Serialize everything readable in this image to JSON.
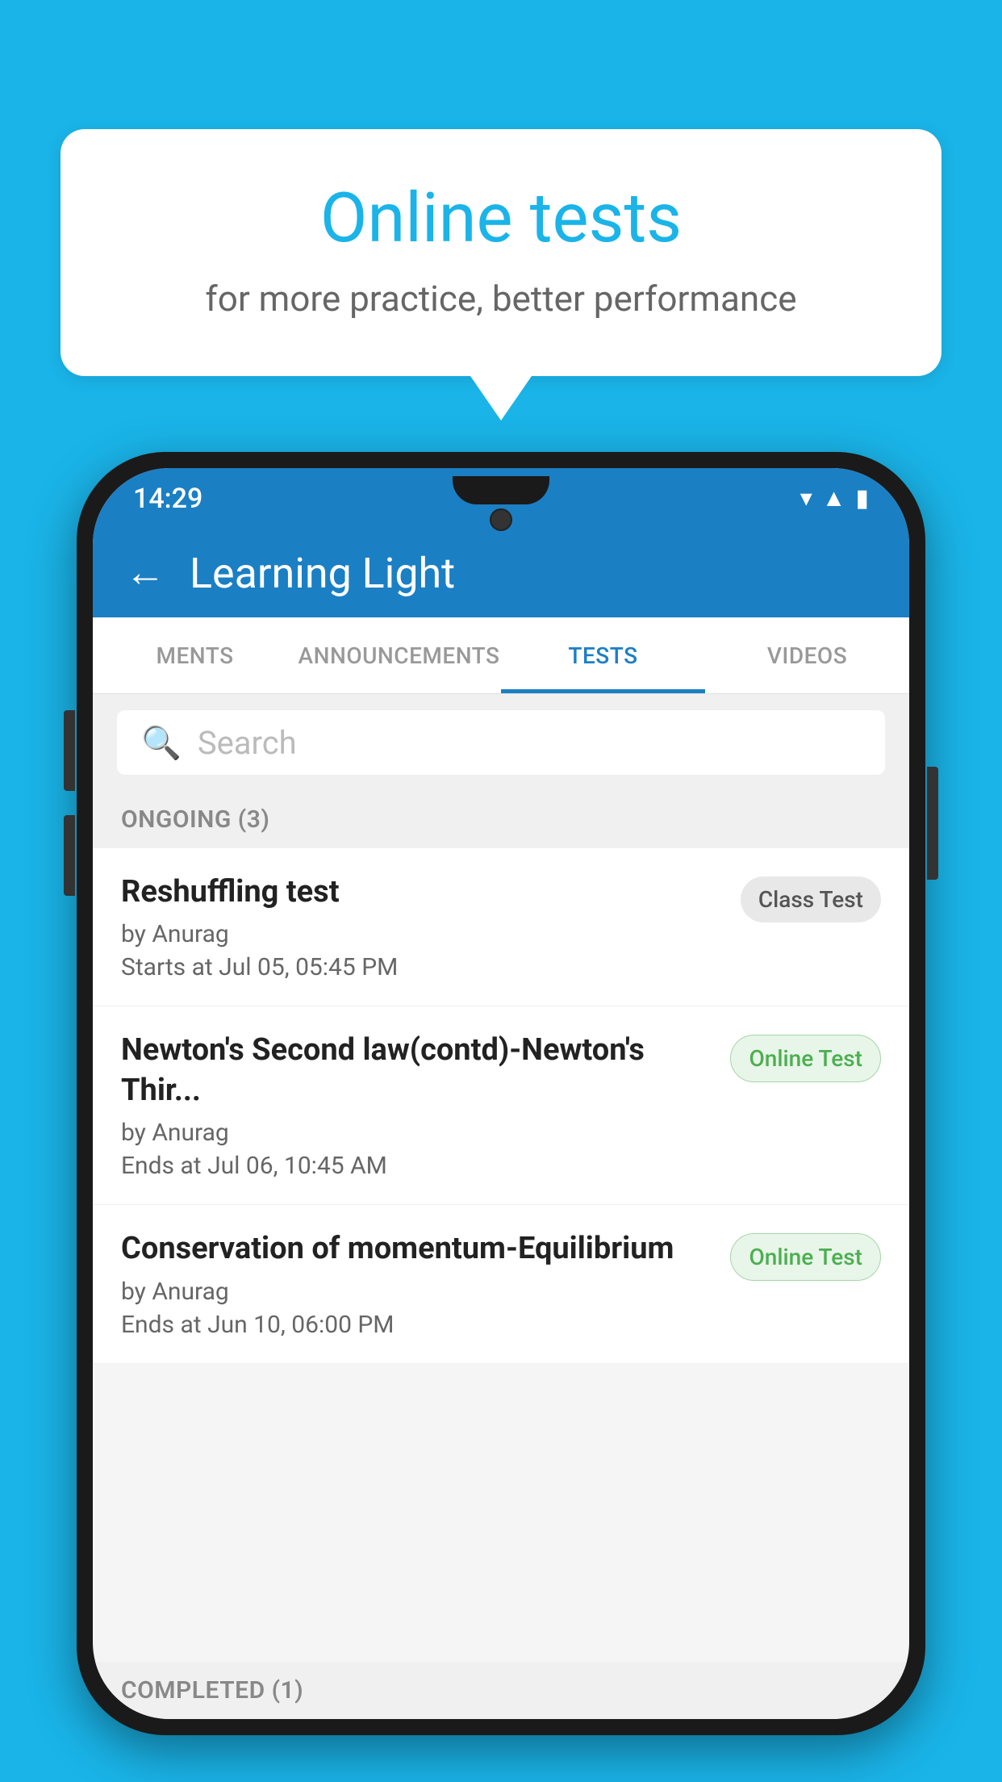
{
  "background_color": "#1ab4e8",
  "speech_bubble": {
    "title": "Online tests",
    "subtitle": "for more practice, better performance"
  },
  "phone": {
    "status_bar": {
      "time": "14:29",
      "wifi": "▾",
      "signal": "◢",
      "battery": "▮"
    },
    "header": {
      "back_label": "←",
      "title": "Learning Light"
    },
    "tabs": [
      {
        "label": "MENTS",
        "active": false
      },
      {
        "label": "ANNOUNCEMENTS",
        "active": false
      },
      {
        "label": "TESTS",
        "active": true
      },
      {
        "label": "VIDEOS",
        "active": false
      }
    ],
    "search": {
      "placeholder": "Search"
    },
    "ongoing_section": {
      "label": "ONGOING (3)"
    },
    "tests": [
      {
        "name": "Reshuffling test",
        "author": "by Anurag",
        "time_label": "Starts at",
        "time": "Jul 05, 05:45 PM",
        "badge": "Class Test",
        "badge_type": "class"
      },
      {
        "name": "Newton's Second law(contd)-Newton's Thir...",
        "author": "by Anurag",
        "time_label": "Ends at",
        "time": "Jul 06, 10:45 AM",
        "badge": "Online Test",
        "badge_type": "online"
      },
      {
        "name": "Conservation of momentum-Equilibrium",
        "author": "by Anurag",
        "time_label": "Ends at",
        "time": "Jun 10, 06:00 PM",
        "badge": "Online Test",
        "badge_type": "online"
      }
    ],
    "completed_section": {
      "label": "COMPLETED (1)"
    }
  }
}
